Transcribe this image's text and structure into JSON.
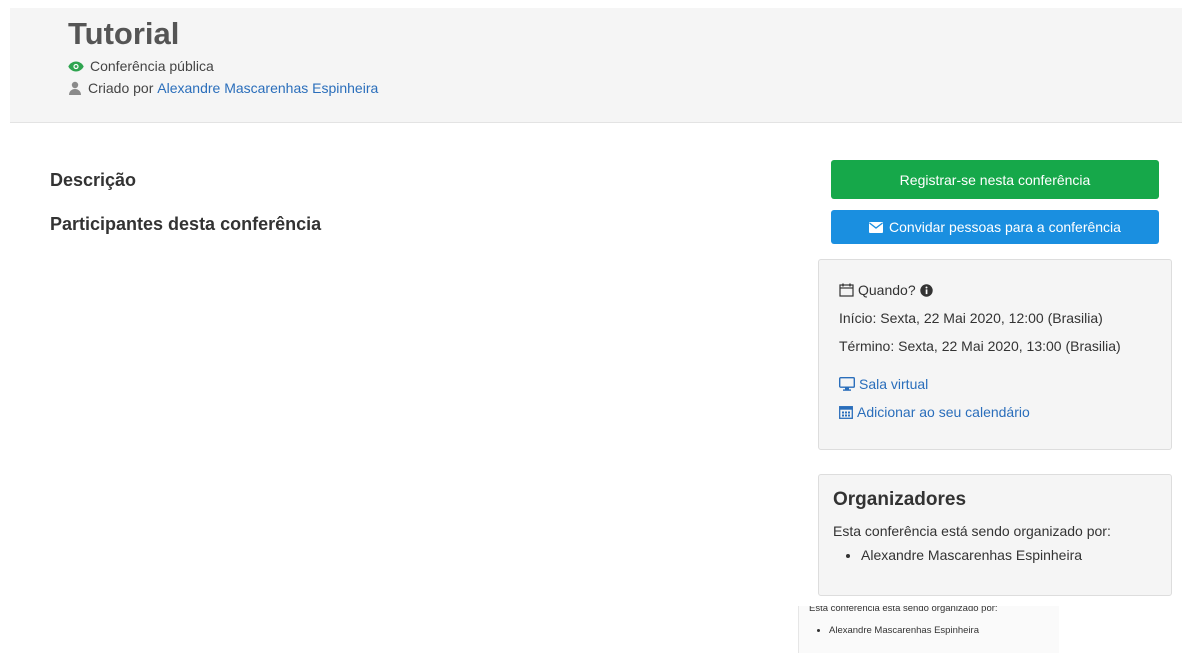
{
  "header": {
    "title": "Tutorial",
    "visibility": "Conferência pública",
    "created_by_prefix": "Criado por ",
    "creator": "Alexandre Mascarenhas Espinheira"
  },
  "main": {
    "description_heading": "Descrição",
    "participants_heading": "Participantes desta conferência"
  },
  "actions": {
    "register_label": "Registrar-se nesta conferência",
    "invite_label": "Convidar pessoas para a conferência"
  },
  "when": {
    "heading": "Quando?",
    "start": "Início: Sexta, 22 Mai 2020, 12:00 (Brasilia)",
    "end": "Término: Sexta, 22 Mai 2020, 13:00 (Brasilia)",
    "virtual_room": "Sala virtual",
    "add_calendar": "Adicionar ao seu calendário"
  },
  "organizers": {
    "heading": "Organizadores",
    "text": "Esta conferência está sendo organizado por:",
    "list": [
      "Alexandre Mascarenhas Espinheira"
    ]
  },
  "ghost": {
    "text": "Esta conferência está sendo organizado por:",
    "item": "Alexandre Mascarenhas Espinheira"
  },
  "colors": {
    "register": "#16a84a",
    "invite": "#1a8fe0",
    "link": "#2a6ebb",
    "eye_icon": "#2ea44f"
  },
  "icons": [
    "eye-icon",
    "user-icon",
    "envelope-icon",
    "calendar-icon",
    "info-icon",
    "monitor-icon",
    "calendar-grid-icon"
  ]
}
